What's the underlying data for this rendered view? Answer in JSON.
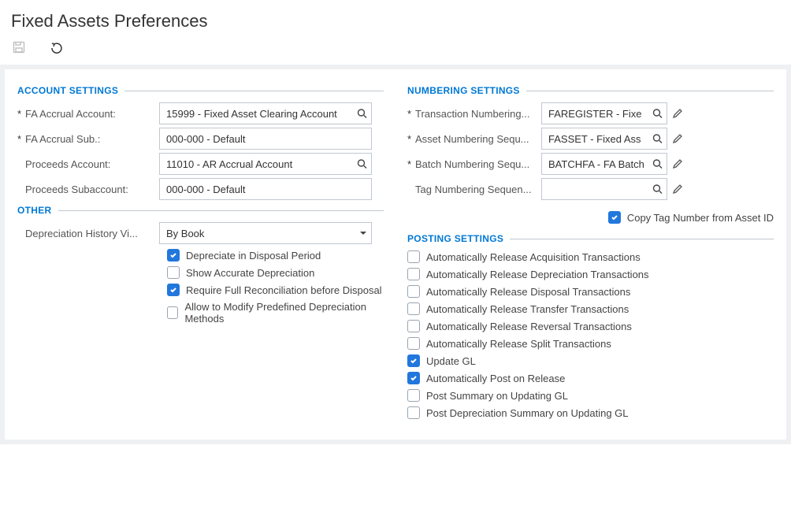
{
  "page": {
    "title": "Fixed Assets Preferences"
  },
  "sections": {
    "account": "ACCOUNT SETTINGS",
    "other": "OTHER",
    "numbering": "NUMBERING SETTINGS",
    "posting": "POSTING SETTINGS"
  },
  "account": {
    "fa_accrual_account": {
      "label": "FA Accrual Account:",
      "value": "15999 - Fixed Asset Clearing Account",
      "required": true
    },
    "fa_accrual_sub": {
      "label": "FA Accrual Sub.:",
      "value": "000-000 - Default",
      "required": true
    },
    "proceeds_account": {
      "label": "Proceeds Account:",
      "value": "11010 - AR Accrual Account",
      "required": false
    },
    "proceeds_sub": {
      "label": "Proceeds Subaccount:",
      "value": "000-000 - Default",
      "required": false
    }
  },
  "other": {
    "dep_history_view": {
      "label": "Depreciation History Vi...",
      "value": "By Book"
    },
    "depreciate_disposal": {
      "label": "Depreciate in Disposal Period",
      "checked": true
    },
    "show_accurate": {
      "label": "Show Accurate Depreciation",
      "checked": false
    },
    "require_reconcile": {
      "label": "Require Full Reconciliation before Disposal",
      "checked": true
    },
    "allow_modify": {
      "label": "Allow to Modify Predefined Depreciation Methods",
      "checked": false
    }
  },
  "numbering": {
    "transaction": {
      "label": "Transaction Numbering...",
      "value": "FAREGISTER - Fixe",
      "required": true
    },
    "asset": {
      "label": "Asset Numbering Sequ...",
      "value": "FASSET - Fixed Ass",
      "required": true
    },
    "batch": {
      "label": "Batch Numbering Sequ...",
      "value": "BATCHFA - FA Batch",
      "required": true
    },
    "tag": {
      "label": "Tag Numbering Sequen...",
      "value": "",
      "required": false
    },
    "copy_tag": {
      "label": "Copy Tag Number from Asset ID",
      "checked": true
    }
  },
  "posting": {
    "auto_acquisition": {
      "label": "Automatically Release Acquisition Transactions",
      "checked": false
    },
    "auto_depreciation": {
      "label": "Automatically Release Depreciation Transactions",
      "checked": false
    },
    "auto_disposal": {
      "label": "Automatically Release Disposal Transactions",
      "checked": false
    },
    "auto_transfer": {
      "label": "Automatically Release Transfer Transactions",
      "checked": false
    },
    "auto_reversal": {
      "label": "Automatically Release Reversal Transactions",
      "checked": false
    },
    "auto_split": {
      "label": "Automatically Release Split Transactions",
      "checked": false
    },
    "update_gl": {
      "label": "Update GL",
      "checked": true
    },
    "auto_post": {
      "label": "Automatically Post on Release",
      "checked": true
    },
    "post_summary": {
      "label": "Post Summary on Updating GL",
      "checked": false
    },
    "post_dep_summary": {
      "label": "Post Depreciation Summary on Updating GL",
      "checked": false
    }
  }
}
